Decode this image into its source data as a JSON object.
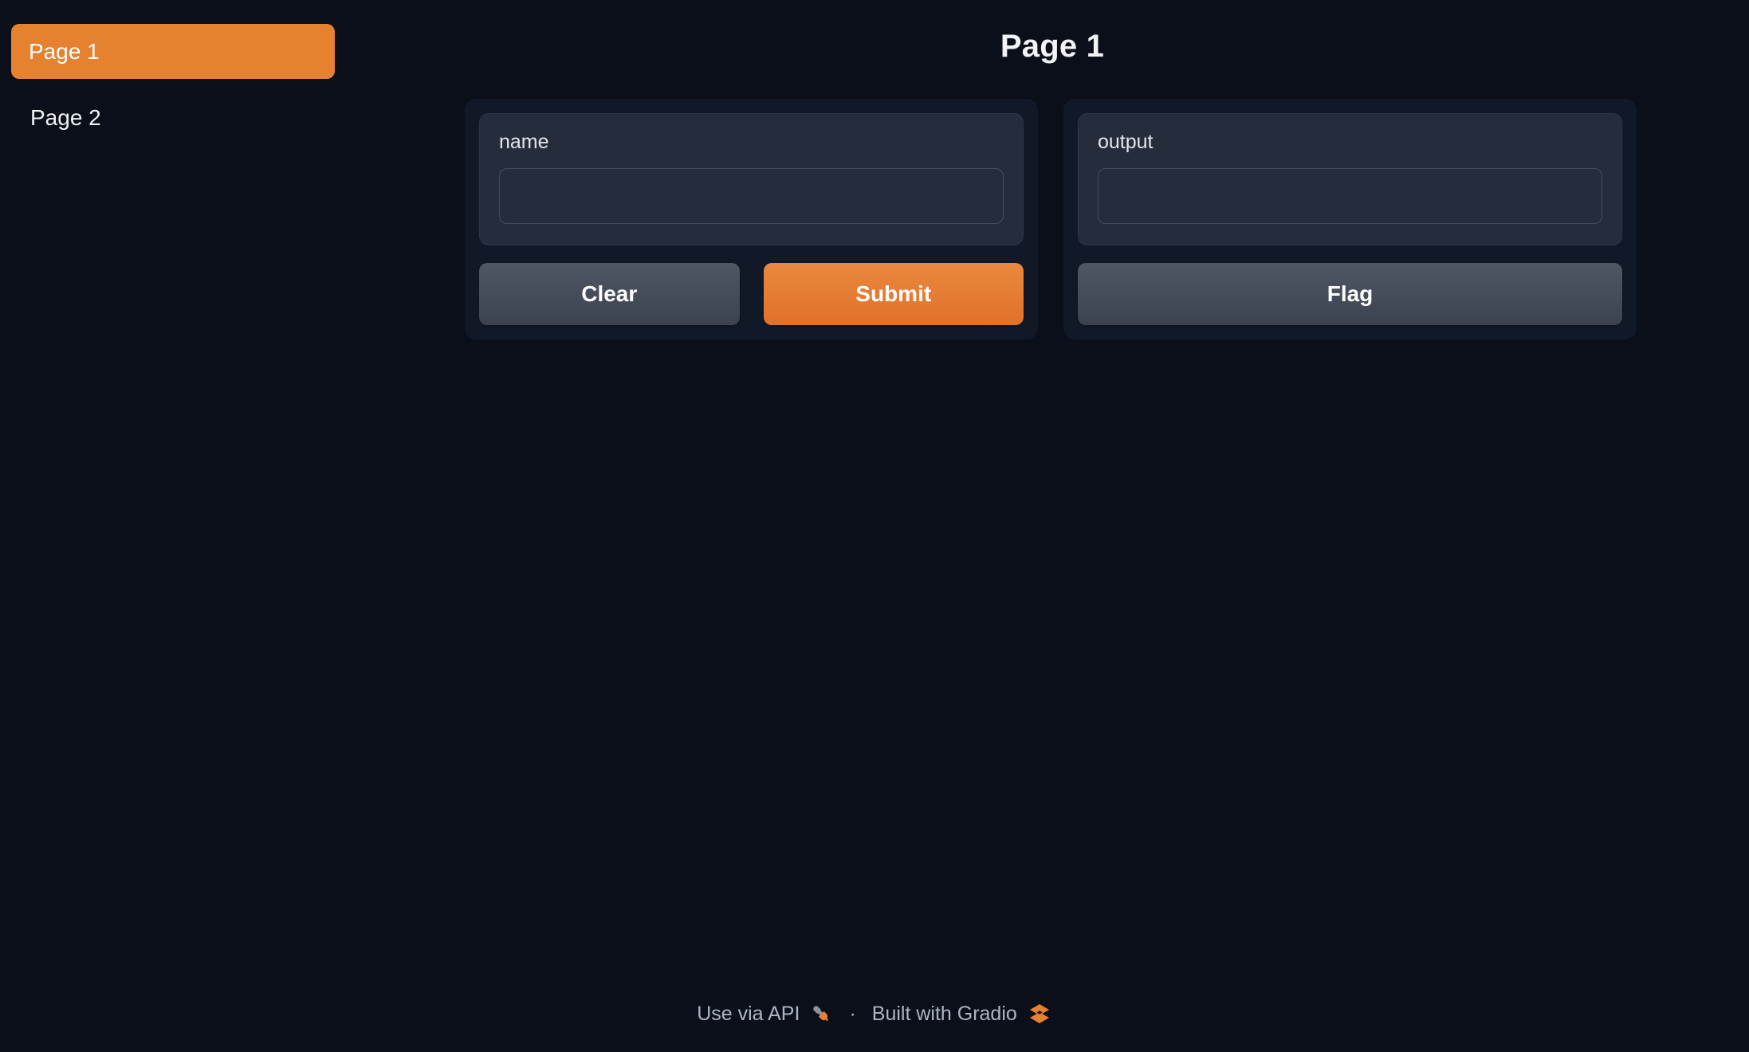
{
  "app": {
    "background_color": "#0b0f19",
    "accent_color": "#e5812f"
  },
  "sidebar": {
    "items": [
      {
        "label": "Page 1",
        "selected": true
      },
      {
        "label": "Page 2",
        "selected": false
      }
    ]
  },
  "header": {
    "title": "Page 1"
  },
  "main": {
    "input_panel": {
      "label": "name",
      "value": "",
      "placeholder": "",
      "buttons": [
        {
          "label": "Clear",
          "variant": "secondary"
        },
        {
          "label": "Submit",
          "variant": "primary"
        }
      ]
    },
    "output_panel": {
      "label": "output",
      "value": "",
      "placeholder": "",
      "buttons": [
        {
          "label": "Flag",
          "variant": "secondary"
        }
      ]
    }
  },
  "footer": {
    "use_via_api": "Use via API",
    "api_icon": "plug-icon",
    "separator": "·",
    "built_with": "Built with Gradio",
    "gradio_icon": "gradio-logo-icon"
  }
}
